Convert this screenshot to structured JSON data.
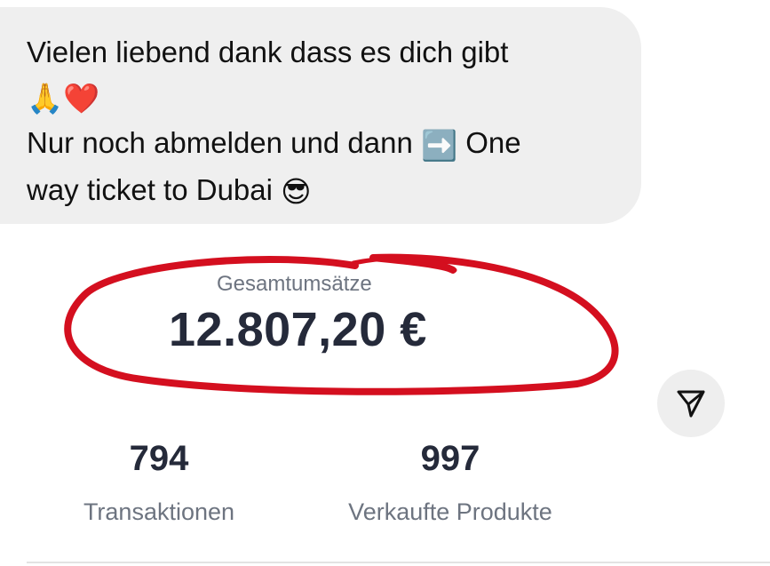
{
  "chat": {
    "line1": "Vielen liebend dank dass es dich gibt",
    "emoji_line": "🙏❤️",
    "line3_text": "Nur noch abmelden und dann",
    "line3_emoji": "➡️",
    "line3_tail": " One",
    "line4_text": "way ticket to Dubai ",
    "line4_emoji": "😎"
  },
  "stats": {
    "total_label": "Gesamtumsätze",
    "total_value": "12.807,20 €",
    "transactions_value": "794",
    "transactions_label": "Transaktionen",
    "products_value": "997",
    "products_label": "Verkaufte Produkte"
  },
  "icons": {
    "share": "paper-plane-icon",
    "highlight": "red-handdrawn-ellipse"
  },
  "colors": {
    "bubble_bg": "#efefef",
    "value_text": "#252a3a",
    "label_text": "#6d7480",
    "highlight": "#d40f1f",
    "share_button_bg": "#eeeeee"
  }
}
